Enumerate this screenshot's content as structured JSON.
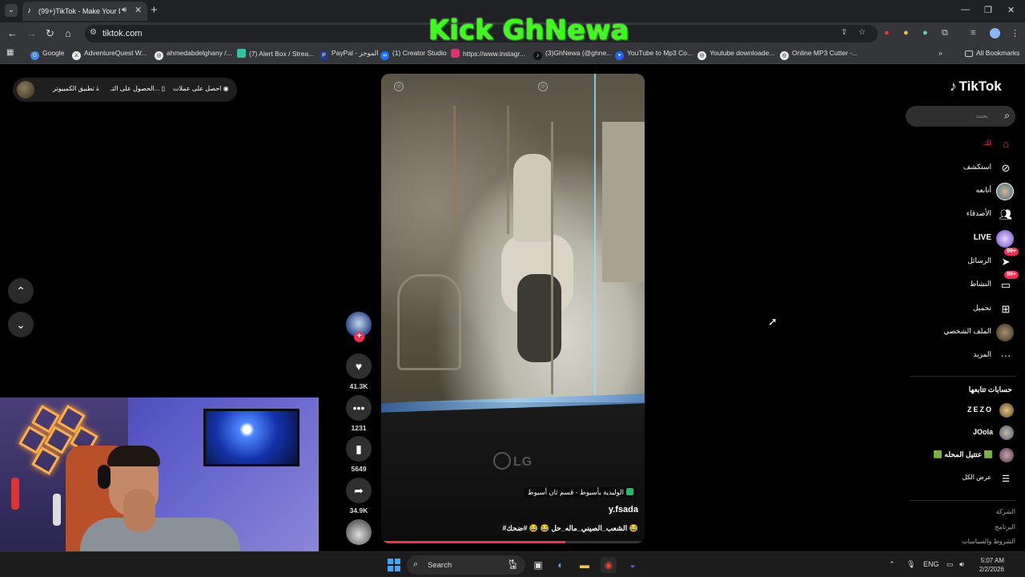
{
  "browser": {
    "tab_title": "(99+)TikTok - Make Your Da",
    "url": "tiktok.com",
    "bookmarks": [
      {
        "label": "Google",
        "color": "#4285f4"
      },
      {
        "label": "AdventureQuest W...",
        "color": "#e0e0e0"
      },
      {
        "label": "ahmedabdelghany /...",
        "color": "#e0e0e0"
      },
      {
        "label": "(7) Alert Box / Strea...",
        "color": "#31c3a2"
      },
      {
        "label": "PayPal - الموجز",
        "color": "#253b80"
      },
      {
        "label": "(1) Creator Studio",
        "color": "#1877f2"
      },
      {
        "label": "https://www.instagr...",
        "color": "#e1306c"
      },
      {
        "label": "(3)GhNewa (@ghne...",
        "color": "#111111"
      },
      {
        "label": "YouTube to Mp3 Co...",
        "color": "#1e66ff"
      },
      {
        "label": "Youtube downloade...",
        "color": "#e0e0e0"
      },
      {
        "label": "Online MP3 Cutter -...",
        "color": "#e0e0e0"
      }
    ],
    "all_bookmarks": "All Bookmarks"
  },
  "overlay_title": "Kick GhNewa",
  "topbar": {
    "earn": "احصل على عملات",
    "get_app": "الحصول على التـ...",
    "desktop_app": "تطبيق الكمبيوتر"
  },
  "video": {
    "location_text": "الوليدية بأسيوط - قسم ثان أسيوط",
    "username": "y.fsada",
    "caption": "#الشعب_الصيني_ماله_حل 😂 😂 #ضحك 😂",
    "progress": 0.7
  },
  "actions": {
    "likes": "41.3K",
    "comments": "1231",
    "saves": "5649",
    "shares": "34.9K"
  },
  "sidebar": {
    "logo": "TikTok",
    "search_placeholder": "بحث",
    "nav": [
      {
        "label": "لك",
        "icon": "home-icon",
        "active": true
      },
      {
        "label": "استكشف",
        "icon": "compass-icon"
      },
      {
        "label": "أتابعه",
        "icon": "avatar-icon"
      },
      {
        "label": "الأصدقاء",
        "icon": "friends-icon"
      },
      {
        "label": "LIVE",
        "icon": "live-icon"
      },
      {
        "label": "الرسائل",
        "icon": "messages-icon",
        "badge": "99+"
      },
      {
        "label": "النشاط",
        "icon": "activity-icon",
        "badge": "99+"
      },
      {
        "label": "تحميل",
        "icon": "upload-icon"
      },
      {
        "label": "الملف الشخصي",
        "icon": "profile-icon"
      },
      {
        "label": "المزيد",
        "icon": "more-icon"
      }
    ],
    "following_title": "حسابات تتابعها",
    "following": [
      {
        "label": "ZEZO"
      },
      {
        "label": "JOola"
      },
      {
        "label": "🟩 عتتيل المحله 🟩"
      }
    ],
    "see_all": "عرض الكل",
    "footer": [
      "الشركة",
      "البرنامج",
      "الشروط والسياسات"
    ]
  },
  "taskbar": {
    "search": "Search",
    "lang": "ENG",
    "time": "5:07 AM",
    "date": "2/2/2026"
  }
}
